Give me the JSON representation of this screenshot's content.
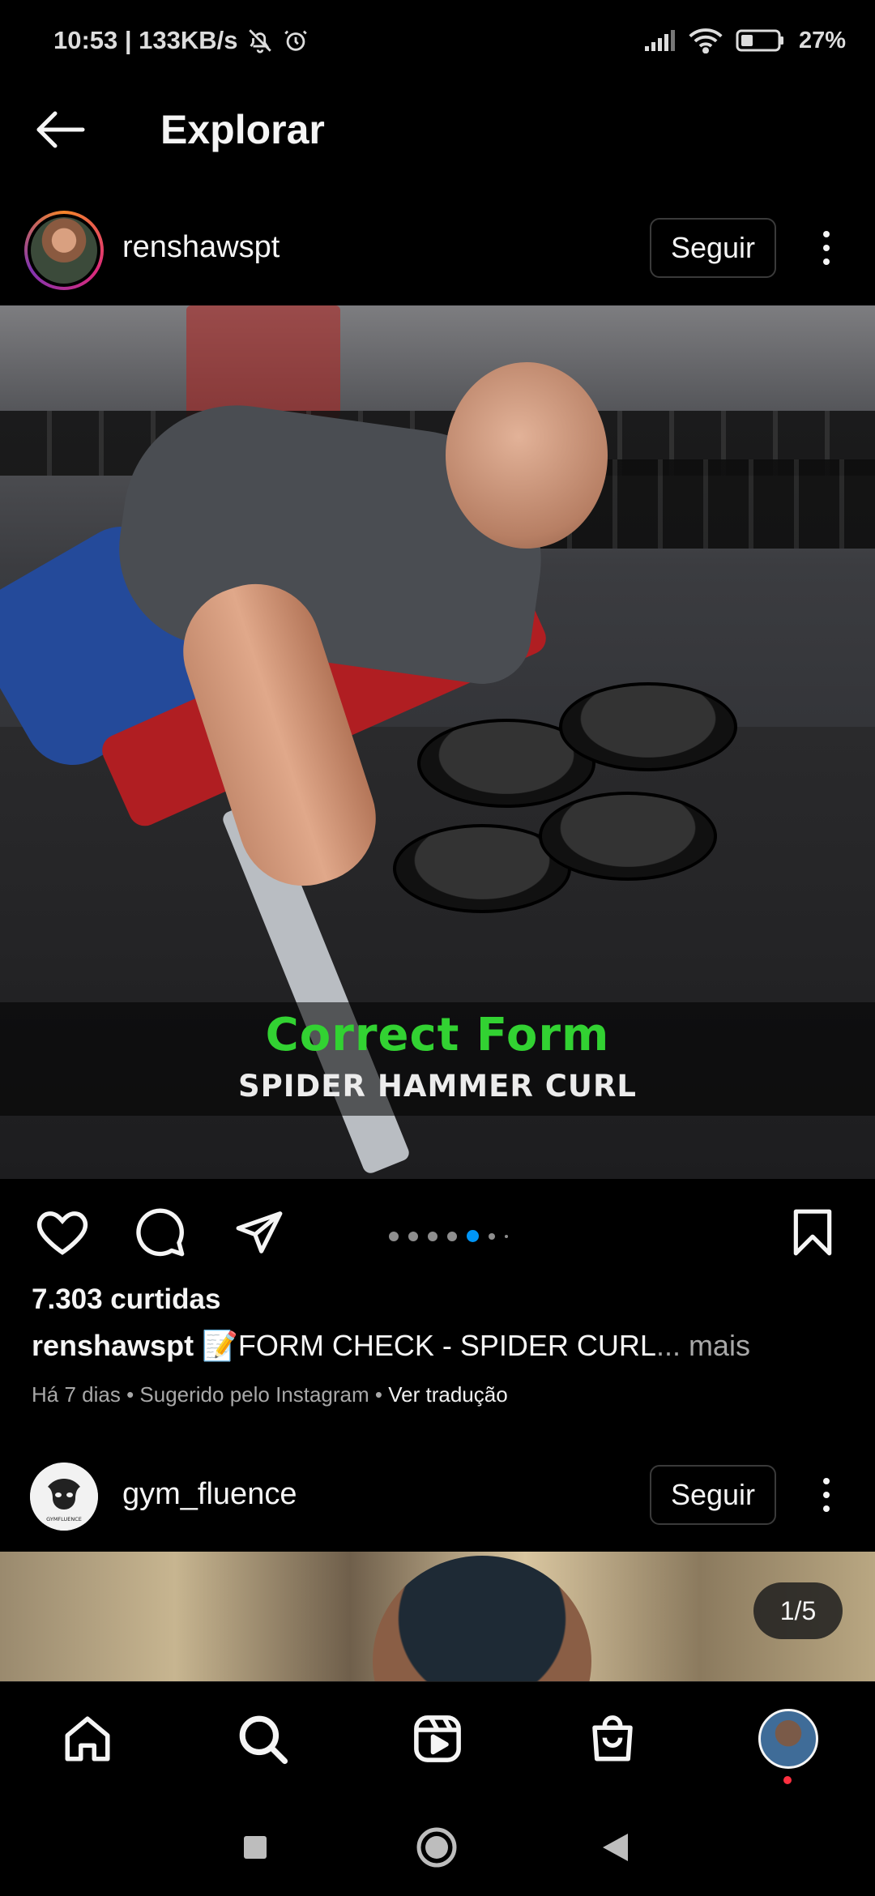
{
  "status_bar": {
    "time_speed": "10:53 | 133KB/s",
    "battery": "27%",
    "icons": [
      "bell-off-icon",
      "alarm-icon",
      "signal-icon",
      "wifi-icon",
      "battery-icon"
    ]
  },
  "top_bar": {
    "title": "Explorar",
    "back_icon": "arrow-left-icon"
  },
  "post1": {
    "username": "renshawspt",
    "follow_label": "Seguir",
    "overlay_title": "Correct Form",
    "overlay_subtitle": "SPIDER HAMMER CURL",
    "carousel": {
      "total": 7,
      "active_index": 4
    },
    "likes": "7.303 curtidas",
    "caption_user": "renshawspt",
    "caption_text": " 📝FORM CHECK - SPIDER CURL",
    "caption_more": "... mais",
    "meta_text": "Há 7 dias • Sugerido pelo Instagram • ",
    "meta_translate": "Ver tradução"
  },
  "post2": {
    "username": "gym_fluence",
    "follow_label": "Seguir",
    "avatar_text": "GYMFLUENCE",
    "counter": "1/5"
  },
  "bottom_nav": {
    "items": [
      "home-icon",
      "search-icon",
      "reels-icon",
      "shop-icon",
      "profile-avatar"
    ]
  },
  "system_nav": [
    "recents-icon",
    "home-circle-icon",
    "back-triangle-icon"
  ],
  "colors": {
    "background": "#000000",
    "text": "#f5f5f5",
    "secondary_text": "#a8a8a8",
    "accent_blue": "#0095f6",
    "overlay_green": "#32d232",
    "notification": "#ff3040"
  }
}
